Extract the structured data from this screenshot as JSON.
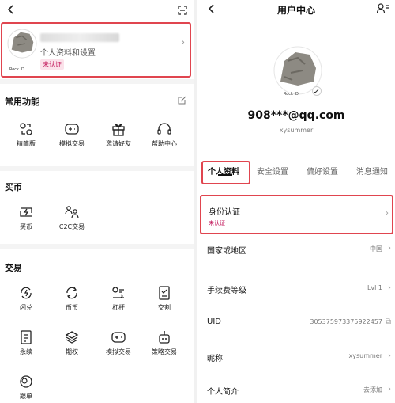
{
  "left": {
    "profile": {
      "subtitle": "个人资料和设置",
      "badge": "未认证",
      "avatar_caption": "Rock ID"
    },
    "sections": [
      {
        "title": "常用功能",
        "items": [
          {
            "label": "精简版",
            "icon": "simple-version-icon"
          },
          {
            "label": "模拟交易",
            "icon": "demo-trade-icon"
          },
          {
            "label": "邀请好友",
            "icon": "gift-icon"
          },
          {
            "label": "帮助中心",
            "icon": "headset-icon"
          }
        ]
      },
      {
        "title": "买币",
        "items": [
          {
            "label": "买币",
            "icon": "buy-crypto-icon"
          },
          {
            "label": "C2C交易",
            "icon": "c2c-icon"
          }
        ]
      },
      {
        "title": "交易",
        "items": [
          {
            "label": "闪兑",
            "icon": "flash-convert-icon"
          },
          {
            "label": "币币",
            "icon": "spot-icon"
          },
          {
            "label": "杠杆",
            "icon": "margin-icon"
          },
          {
            "label": "交割",
            "icon": "delivery-icon"
          },
          {
            "label": "永续",
            "icon": "perpetual-icon"
          },
          {
            "label": "期权",
            "icon": "options-icon"
          },
          {
            "label": "模拟交易",
            "icon": "demo-trade-icon"
          },
          {
            "label": "策略交易",
            "icon": "robot-icon"
          },
          {
            "label": "跟单",
            "icon": "copy-trade-icon"
          }
        ]
      }
    ]
  },
  "right": {
    "title": "用户中心",
    "avatar_caption": "Rock ID",
    "email": "908***@qq.com",
    "username": "xysummer",
    "tabs": [
      "个人资料",
      "安全设置",
      "偏好设置",
      "消息通知"
    ],
    "identity": {
      "label": "身份认证",
      "status": "未认证"
    },
    "rows": [
      {
        "label": "国家或地区",
        "value": "中国",
        "suffix": "›"
      },
      {
        "label": "手续费等级",
        "value": "Lvl 1",
        "suffix": "›"
      },
      {
        "label": "UID",
        "value": "305375973375922457",
        "suffix": "⧉"
      },
      {
        "label": "昵称",
        "value": "xysummer",
        "suffix": "›"
      },
      {
        "label": "个人简介",
        "value": "去添加",
        "suffix": "›"
      }
    ]
  },
  "colors": {
    "highlight": "#e0454f",
    "badge_text": "#c2185b",
    "badge_bg": "#fbe2ea"
  }
}
